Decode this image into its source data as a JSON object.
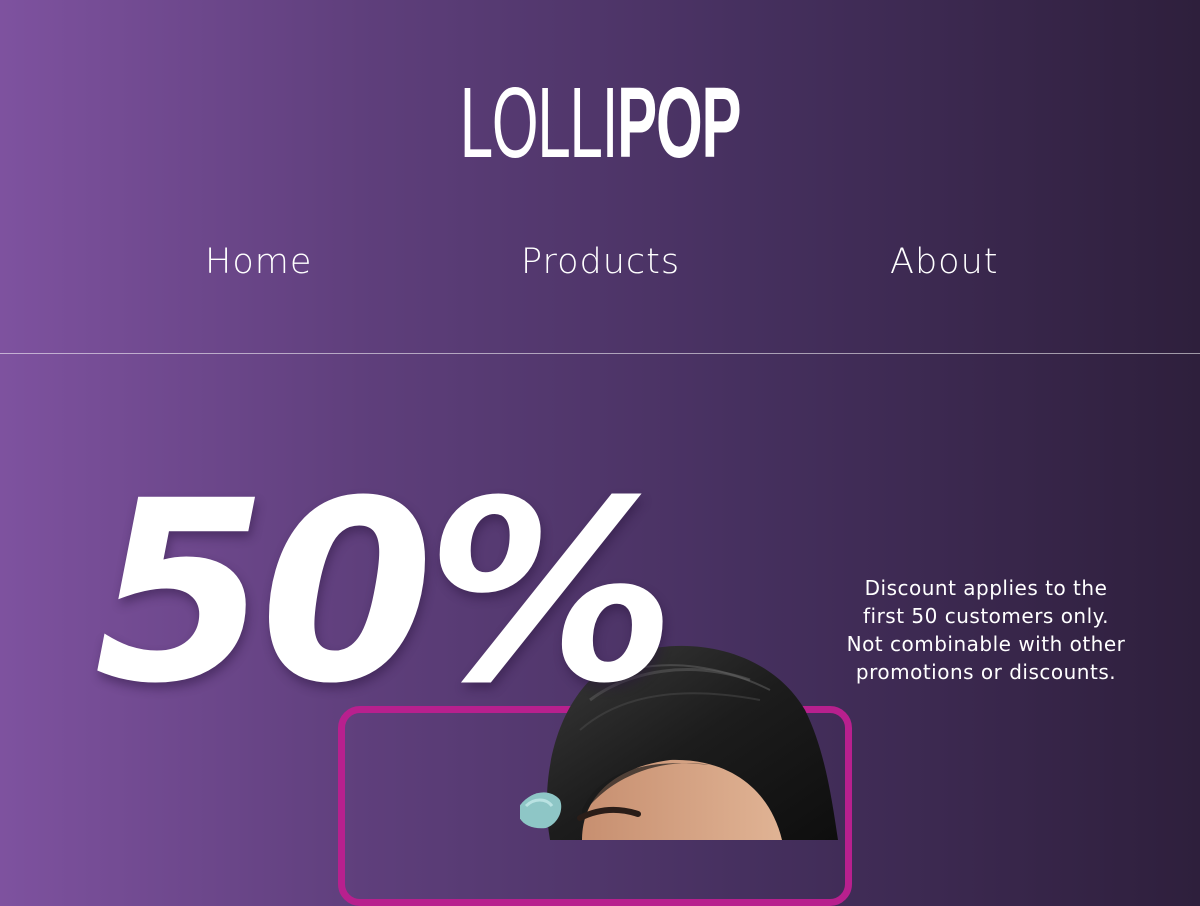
{
  "brand": {
    "logo_part1": "LOLLI",
    "logo_part2": "POP"
  },
  "nav": {
    "items": [
      {
        "label": "Home"
      },
      {
        "label": "Products"
      },
      {
        "label": "About"
      }
    ]
  },
  "promo": {
    "headline": "50%",
    "disclaimer_lines": [
      "Discount  applies to the",
      "first 50 customers only.",
      "Not combinable with other",
      "promotions or discounts."
    ]
  },
  "colors": {
    "gradient_left": "#7e529f",
    "gradient_right": "#2e1f3c",
    "frame_accent": "#b8208e",
    "text": "#ffffff"
  }
}
